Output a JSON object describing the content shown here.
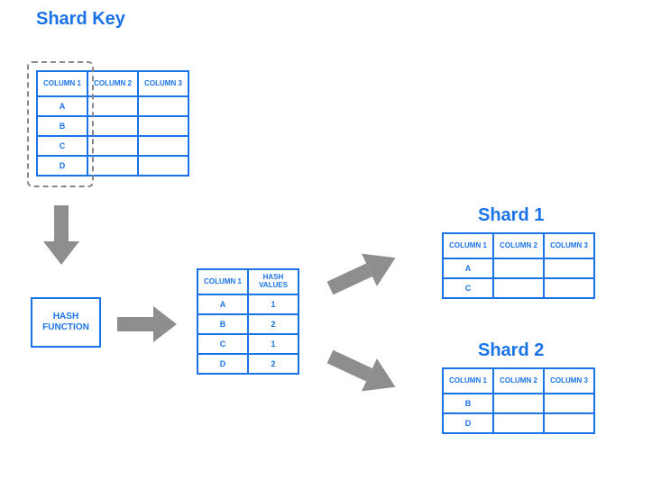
{
  "titles": {
    "shard_key": "Shard Key",
    "shard1": "Shard 1",
    "shard2": "Shard 2"
  },
  "hash_function_label": "HASH FUNCTION",
  "source_table": {
    "headers": [
      "COLUMN 1",
      "COLUMN 2",
      "COLUMN 3"
    ],
    "rows": [
      [
        "A",
        "",
        ""
      ],
      [
        "B",
        "",
        ""
      ],
      [
        "C",
        "",
        ""
      ],
      [
        "D",
        "",
        ""
      ]
    ]
  },
  "hash_table": {
    "headers": [
      "COLUMN 1",
      "HASH VALUES"
    ],
    "rows": [
      [
        "A",
        "1"
      ],
      [
        "B",
        "2"
      ],
      [
        "C",
        "1"
      ],
      [
        "D",
        "2"
      ]
    ]
  },
  "shard1_table": {
    "headers": [
      "COLUMN 1",
      "COLUMN 2",
      "COLUMN 3"
    ],
    "rows": [
      [
        "A",
        "",
        ""
      ],
      [
        "C",
        "",
        ""
      ]
    ]
  },
  "shard2_table": {
    "headers": [
      "COLUMN 1",
      "COLUMN 2",
      "COLUMN 3"
    ],
    "rows": [
      [
        "B",
        "",
        ""
      ],
      [
        "D",
        "",
        ""
      ]
    ]
  },
  "chart_data": {
    "type": "table",
    "description": "Hash-based sharding diagram",
    "shard_key_column": "COLUMN 1",
    "rows": [
      {
        "key": "A",
        "hash": 1,
        "shard": "Shard 1"
      },
      {
        "key": "B",
        "hash": 2,
        "shard": "Shard 2"
      },
      {
        "key": "C",
        "hash": 1,
        "shard": "Shard 1"
      },
      {
        "key": "D",
        "hash": 2,
        "shard": "Shard 2"
      }
    ]
  }
}
